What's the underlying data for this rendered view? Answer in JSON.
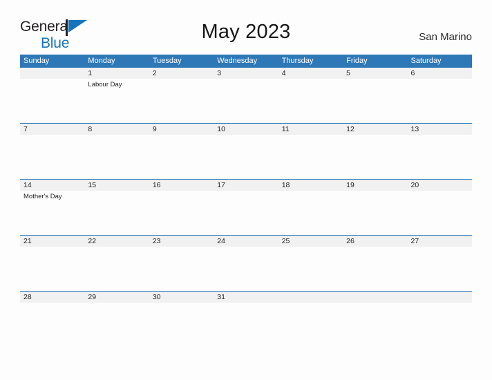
{
  "brand": {
    "name_top": "General",
    "name_bottom": "Blue",
    "flag_color": "#1574bb",
    "text_color": "#231f20"
  },
  "header": {
    "title": "May 2023",
    "region": "San Marino"
  },
  "calendar": {
    "accent_color": "#2e78b8",
    "band_color": "#f1f1f1",
    "weekdays": [
      "Sunday",
      "Monday",
      "Tuesday",
      "Wednesday",
      "Thursday",
      "Friday",
      "Saturday"
    ],
    "weeks": [
      {
        "days": [
          {
            "num": "",
            "event": ""
          },
          {
            "num": "1",
            "event": "Labour Day"
          },
          {
            "num": "2",
            "event": ""
          },
          {
            "num": "3",
            "event": ""
          },
          {
            "num": "4",
            "event": ""
          },
          {
            "num": "5",
            "event": ""
          },
          {
            "num": "6",
            "event": ""
          }
        ]
      },
      {
        "days": [
          {
            "num": "7",
            "event": ""
          },
          {
            "num": "8",
            "event": ""
          },
          {
            "num": "9",
            "event": ""
          },
          {
            "num": "10",
            "event": ""
          },
          {
            "num": "11",
            "event": ""
          },
          {
            "num": "12",
            "event": ""
          },
          {
            "num": "13",
            "event": ""
          }
        ]
      },
      {
        "days": [
          {
            "num": "14",
            "event": "Mother's Day"
          },
          {
            "num": "15",
            "event": ""
          },
          {
            "num": "16",
            "event": ""
          },
          {
            "num": "17",
            "event": ""
          },
          {
            "num": "18",
            "event": ""
          },
          {
            "num": "19",
            "event": ""
          },
          {
            "num": "20",
            "event": ""
          }
        ]
      },
      {
        "days": [
          {
            "num": "21",
            "event": ""
          },
          {
            "num": "22",
            "event": ""
          },
          {
            "num": "23",
            "event": ""
          },
          {
            "num": "24",
            "event": ""
          },
          {
            "num": "25",
            "event": ""
          },
          {
            "num": "26",
            "event": ""
          },
          {
            "num": "27",
            "event": ""
          }
        ]
      },
      {
        "days": [
          {
            "num": "28",
            "event": ""
          },
          {
            "num": "29",
            "event": ""
          },
          {
            "num": "30",
            "event": ""
          },
          {
            "num": "31",
            "event": ""
          },
          {
            "num": "",
            "event": ""
          },
          {
            "num": "",
            "event": ""
          },
          {
            "num": "",
            "event": ""
          }
        ]
      }
    ]
  }
}
